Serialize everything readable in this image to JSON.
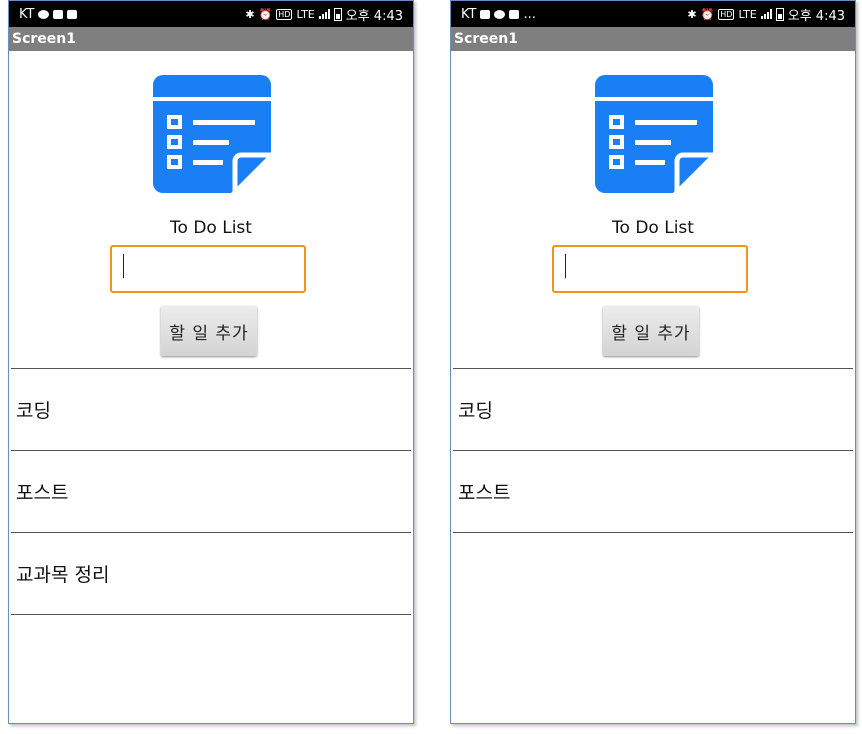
{
  "statusbar": {
    "left": {
      "carrier": "KT",
      "extra": "..."
    },
    "right": {
      "lte": "LTE",
      "time": "오후 4:43"
    }
  },
  "app": {
    "screen_title": "Screen1",
    "title": "To Do List",
    "input_value": "",
    "add_button_label": "할 일 추가"
  },
  "phones": [
    {
      "items": [
        "코딩",
        "포스트",
        "교과목 정리"
      ]
    },
    {
      "items": [
        "코딩",
        "포스트"
      ]
    }
  ],
  "colors": {
    "accent_blue": "#1a7ff5",
    "input_border": "#f39318",
    "titlebar": "#7f7f7f"
  },
  "icons": {
    "logo": "todo-list-document-icon"
  }
}
